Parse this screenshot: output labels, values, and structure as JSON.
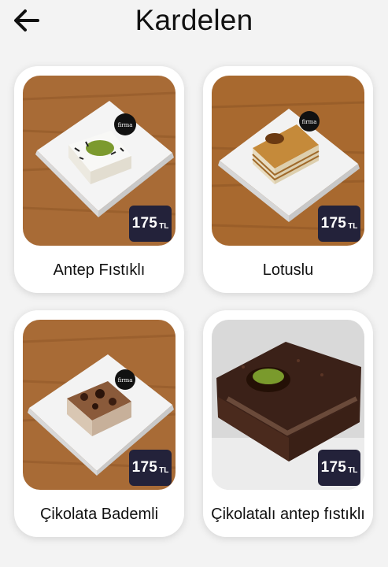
{
  "header": {
    "title": "Kardelen",
    "back_icon": "arrow-left-icon"
  },
  "colors": {
    "background": "#f3f3f3",
    "card": "#ffffff",
    "price_badge": "#23223a",
    "price_text": "#ffffff"
  },
  "products": [
    {
      "name": "Antep Fıstıklı",
      "price": "175",
      "currency": "TL",
      "image": "pistachio-cake-photo"
    },
    {
      "name": "Lotuslu",
      "price": "175",
      "currency": "TL",
      "image": "lotus-cake-photo"
    },
    {
      "name": "Çikolata Bademli",
      "price": "175",
      "currency": "TL",
      "image": "chocolate-almond-cake-photo"
    },
    {
      "name": "Çikolatalı antep fıstıklı",
      "price": "175",
      "currency": "TL",
      "image": "chocolate-pistachio-cake-photo"
    }
  ]
}
